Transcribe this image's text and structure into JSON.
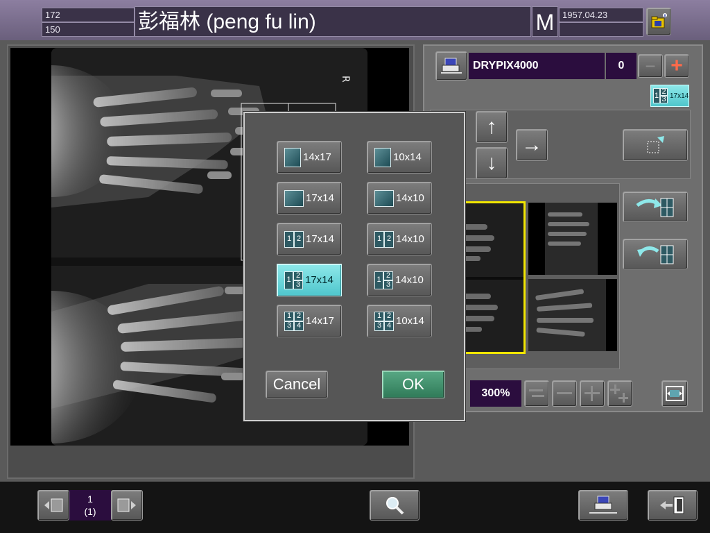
{
  "header": {
    "field_top_left": "172",
    "field_bottom_left": "150",
    "patient_name": "彭福林 (peng fu lin)",
    "sex": "M",
    "birth_date": "1957.04.23",
    "folder_icon": "folder-info-icon"
  },
  "printer": {
    "icon": "printer-icon",
    "name": "DRYPIX4000",
    "copies": "0",
    "minus_label": "−",
    "plus_label": "+",
    "layout_badge": "17x14",
    "layout_badge_cells": [
      "1",
      "2",
      "3"
    ]
  },
  "arrows": {
    "up": "↑",
    "down": "↓",
    "right": "→"
  },
  "zoom": {
    "value": "300%"
  },
  "dialog": {
    "formats": [
      {
        "label": "14x17",
        "glyph": "single-portrait",
        "cells": []
      },
      {
        "label": "10x14",
        "glyph": "single-portrait",
        "cells": []
      },
      {
        "label": "17x14",
        "glyph": "single-landscape",
        "cells": []
      },
      {
        "label": "14x10",
        "glyph": "single-landscape",
        "cells": []
      },
      {
        "label": "17x14",
        "glyph": "two-up",
        "cells": [
          "1",
          "2"
        ]
      },
      {
        "label": "14x10",
        "glyph": "two-up",
        "cells": [
          "1",
          "2"
        ]
      },
      {
        "label": "17x14",
        "glyph": "three-up",
        "cells": [
          "1",
          "2",
          "3"
        ],
        "selected": true
      },
      {
        "label": "14x10",
        "glyph": "three-up",
        "cells": [
          "1",
          "2",
          "3"
        ]
      },
      {
        "label": "14x17",
        "glyph": "four-up",
        "cells": [
          "1",
          "2",
          "3",
          "4"
        ]
      },
      {
        "label": "10x14",
        "glyph": "four-up",
        "cells": [
          "1",
          "2",
          "3",
          "4"
        ]
      }
    ],
    "cancel_label": "Cancel",
    "ok_label": "OK"
  },
  "pager": {
    "page": "1",
    "total": "(1)"
  },
  "colors": {
    "accent_cyan": "#5fd6dc",
    "ok_green": "#3f8f6a",
    "purple_field": "#2b0d3e",
    "selection_yellow": "#f2e600"
  }
}
